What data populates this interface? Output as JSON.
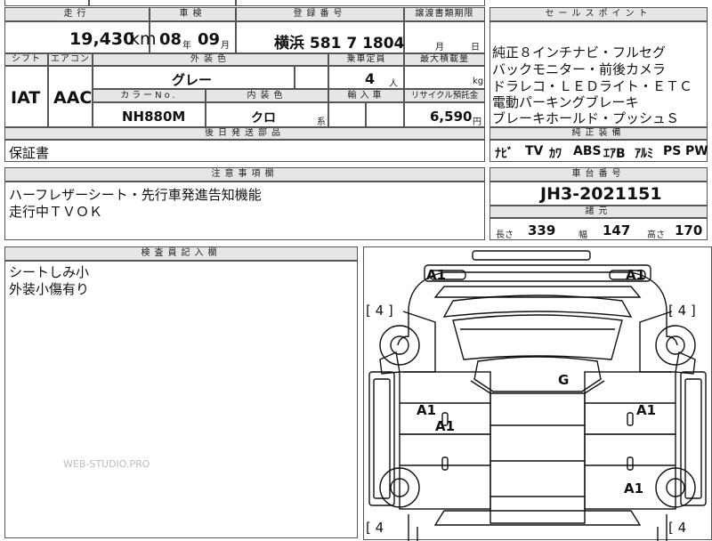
{
  "headers": {
    "mileage": "走行",
    "inspection": "車検",
    "registration": "登録番号",
    "transfer_deadline": "譲渡書類期限",
    "sales_point": "セールスポイント",
    "shift": "シフト",
    "aircon": "エアコン",
    "exterior_color": "外装色",
    "capacity": "乗車定員",
    "max_load": "最大積載量",
    "color_no": "カラーNo.",
    "interior_color": "内装色",
    "import": "輸入車",
    "recycle": "リサイクル預託金",
    "later_parts": "後日発送部品",
    "genuine": "純正装備",
    "notes": "注意事項欄",
    "chassis": "車台番号",
    "dimensions": "諸元",
    "inspector": "検査員記入欄"
  },
  "values": {
    "mileage": "19,430",
    "mileage_unit": "km",
    "inspection_year": "08",
    "inspection_year_unit": "年",
    "inspection_month": "09",
    "inspection_month_unit": "月",
    "registration": "横浜 581 7 1804",
    "transfer_month_unit": "月",
    "transfer_day_unit": "日",
    "shift": "IAT",
    "aircon": "AAC",
    "exterior_color": "グレー",
    "capacity": "4",
    "capacity_unit": "人",
    "max_load_unit": "kg",
    "color_no": "NH880M",
    "interior_color": "クロ",
    "interior_suffix": "系",
    "recycle": "6,590",
    "recycle_unit": "円",
    "later_parts": "保証書",
    "chassis": "JH3-2021151",
    "length_label": "長さ",
    "length": "339",
    "width_label": "幅",
    "width": "147",
    "height_label": "高さ",
    "height": "170"
  },
  "sales_points": [
    "純正８インチナビ・フルセグ",
    "バックモニター・前後カメラ",
    "ドラレコ・ＬＥＤライト・ＥＴＣ",
    "電動パーキングブレーキ",
    "ブレーキホールド・プッシュＳ"
  ],
  "genuine_equipment": [
    "ﾅﾋﾞ",
    "TV",
    "ｶﾜ",
    "ABS",
    "ｴｱB",
    "ｱﾙﾐ",
    "PS",
    "PW"
  ],
  "notes": [
    "ハーフレザーシート・先行車発進告知機能",
    "走行中ＴＶＯＫ"
  ],
  "inspector_notes": [
    "シートしみ小",
    "外装小傷有り"
  ],
  "diagram": {
    "marks": {
      "front_left": "A1",
      "front_right": "A1",
      "roof": "G",
      "left_door": "A1",
      "left_door_lower": "A1",
      "right_door": "A1",
      "rear_right": "A1"
    },
    "tires": {
      "front_left": "[ 4 ]",
      "front_right": "[ 4 ]",
      "rear_left": "[ 4",
      "rear_right": "[ 4"
    }
  },
  "watermark": "WEB-STUDIO.PRO"
}
